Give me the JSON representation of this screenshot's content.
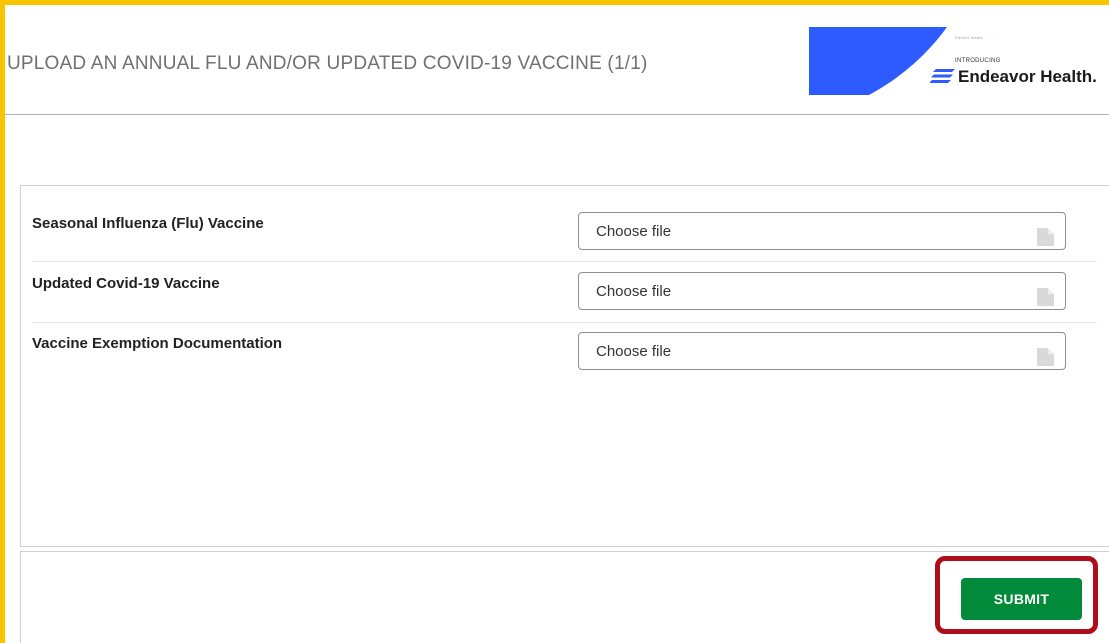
{
  "header": {
    "title": "UPLOAD AN ANNUAL FLU AND/OR UPDATED COVID-19 VACCINE (1/1)"
  },
  "logo": {
    "intro": "INTRODUCING",
    "name": "Endeavor Health.",
    "brand_color": "#2d5bff"
  },
  "form": {
    "fields": [
      {
        "label": "Seasonal Influenza (Flu) Vaccine",
        "value": "Choose file"
      },
      {
        "label": "Updated Covid-19 Vaccine",
        "value": "Choose file"
      },
      {
        "label": "Vaccine Exemption Documentation",
        "value": "Choose file"
      }
    ]
  },
  "footer": {
    "submit_label": "SUBMIT",
    "submit_color": "#008a3a",
    "highlight_color": "#b00d1c"
  }
}
